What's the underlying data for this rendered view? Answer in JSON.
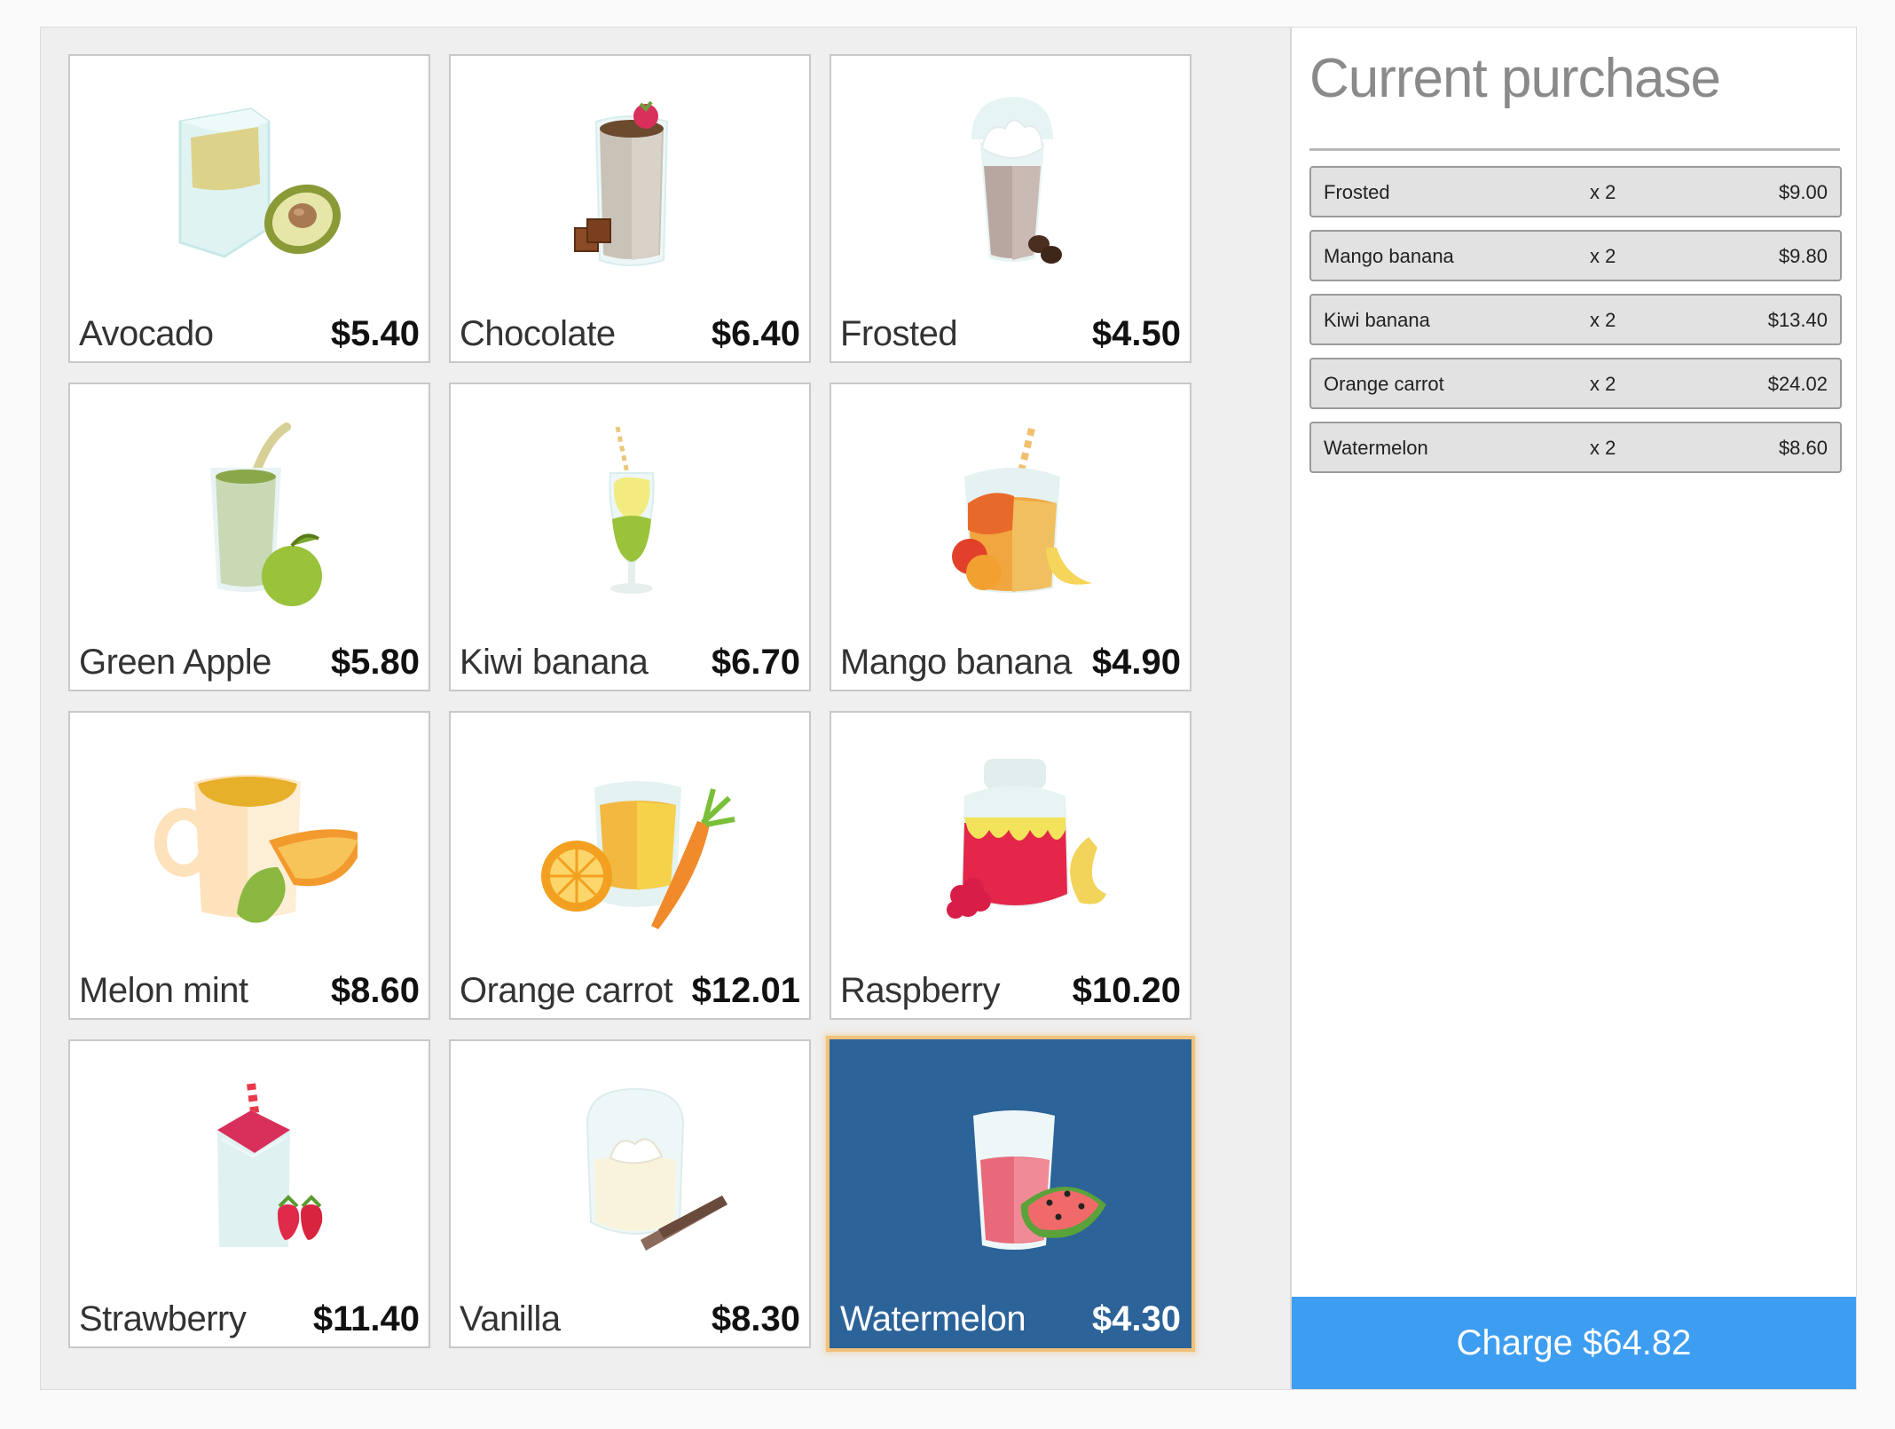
{
  "products": [
    {
      "name": "Avocado",
      "price": "$5.40",
      "icon": "avocado-smoothie-icon"
    },
    {
      "name": "Chocolate",
      "price": "$6.40",
      "icon": "chocolate-smoothie-icon"
    },
    {
      "name": "Frosted",
      "price": "$4.50",
      "icon": "frosted-smoothie-icon"
    },
    {
      "name": "Green Apple",
      "price": "$5.80",
      "icon": "green-apple-smoothie-icon"
    },
    {
      "name": "Kiwi banana",
      "price": "$6.70",
      "icon": "kiwi-banana-smoothie-icon"
    },
    {
      "name": "Mango banana",
      "price": "$4.90",
      "icon": "mango-banana-smoothie-icon"
    },
    {
      "name": "Melon mint",
      "price": "$8.60",
      "icon": "melon-mint-smoothie-icon"
    },
    {
      "name": "Orange carrot",
      "price": "$12.01",
      "icon": "orange-carrot-smoothie-icon"
    },
    {
      "name": "Raspberry",
      "price": "$10.20",
      "icon": "raspberry-smoothie-icon"
    },
    {
      "name": "Strawberry",
      "price": "$11.40",
      "icon": "strawberry-smoothie-icon"
    },
    {
      "name": "Vanilla",
      "price": "$8.30",
      "icon": "vanilla-smoothie-icon"
    },
    {
      "name": "Watermelon",
      "price": "$4.30",
      "icon": "watermelon-smoothie-icon",
      "selected": true
    }
  ],
  "purchase": {
    "title": "Current purchase",
    "items": [
      {
        "name": "Frosted",
        "qty": "x 2",
        "price": "$9.00"
      },
      {
        "name": "Mango banana",
        "qty": "x 2",
        "price": "$9.80"
      },
      {
        "name": "Kiwi banana",
        "qty": "x 2",
        "price": "$13.40"
      },
      {
        "name": "Orange carrot",
        "qty": "x 2",
        "price": "$24.02"
      },
      {
        "name": "Watermelon",
        "qty": "x 2",
        "price": "$8.60"
      }
    ],
    "charge_label": "Charge $64.82"
  },
  "colors": {
    "app_bg": "#efefef",
    "selected_card": "#2c6399",
    "selected_outline": "#f0c27c",
    "charge_button": "#3d9df0"
  }
}
